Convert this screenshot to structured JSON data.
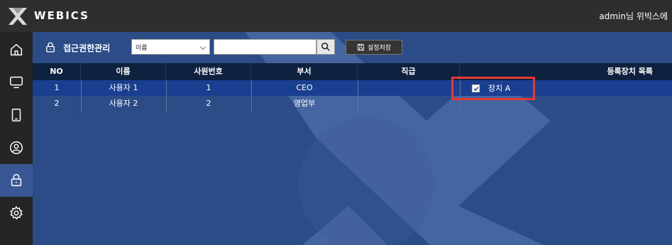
{
  "app": {
    "brand": "WEBICS",
    "user": "admin님 위빅스에"
  },
  "sidebar": {
    "items": [
      {
        "name": "home-icon",
        "active": false
      },
      {
        "name": "monitor-icon",
        "active": false
      },
      {
        "name": "tablet-icon",
        "active": false
      },
      {
        "name": "user-circle-icon",
        "active": false
      },
      {
        "name": "lock-icon",
        "active": true
      },
      {
        "name": "gear-icon",
        "active": false
      }
    ]
  },
  "toolbar": {
    "title": "접근권한관리",
    "filter_value": "이름",
    "search_value": "",
    "save_label": "설정저장"
  },
  "table": {
    "headers": [
      "NO",
      "이름",
      "사원번호",
      "부서",
      "직급",
      "등록장치 목록"
    ],
    "rows": [
      {
        "no": "1",
        "name": "사용자 1",
        "emp_no": "1",
        "dept": "CEO",
        "rank": ""
      },
      {
        "no": "2",
        "name": "사용자 2",
        "emp_no": "2",
        "dept": "영업부",
        "rank": ""
      }
    ]
  },
  "devices": {
    "item_label": "장치 A",
    "checked": true
  },
  "colors": {
    "main_bg": "#2c4c87",
    "header_bg": "#0e213f",
    "selected_row": "#1b3f90",
    "highlight": "#e53935"
  }
}
